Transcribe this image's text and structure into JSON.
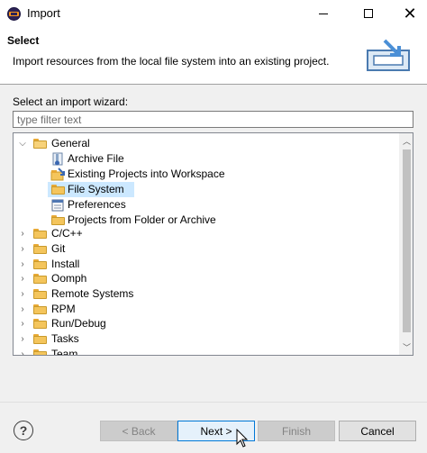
{
  "window": {
    "title": "Import"
  },
  "header": {
    "title": "Select",
    "description": "Import resources from the local file system into an existing project."
  },
  "wizard": {
    "label": "Select an import wizard:",
    "filter_placeholder": "type filter text",
    "filter_value": ""
  },
  "tree": {
    "items": [
      {
        "label": "General",
        "level": 0,
        "expanded": true,
        "icon": "folder-open-icon"
      },
      {
        "label": "Archive File",
        "level": 1,
        "icon": "archive-file-icon"
      },
      {
        "label": "Existing Projects into Workspace",
        "level": 1,
        "icon": "existing-projects-icon"
      },
      {
        "label": "File System",
        "level": 1,
        "icon": "folder-icon",
        "selected": true
      },
      {
        "label": "Preferences",
        "level": 1,
        "icon": "preferences-icon"
      },
      {
        "label": "Projects from Folder or Archive",
        "level": 1,
        "icon": "folder-icon"
      },
      {
        "label": "C/C++",
        "level": 0,
        "expanded": false,
        "icon": "folder-icon"
      },
      {
        "label": "Git",
        "level": 0,
        "expanded": false,
        "icon": "folder-icon"
      },
      {
        "label": "Install",
        "level": 0,
        "expanded": false,
        "icon": "folder-icon"
      },
      {
        "label": "Oomph",
        "level": 0,
        "expanded": false,
        "icon": "folder-icon"
      },
      {
        "label": "Remote Systems",
        "level": 0,
        "expanded": false,
        "icon": "folder-icon"
      },
      {
        "label": "RPM",
        "level": 0,
        "expanded": false,
        "icon": "folder-icon"
      },
      {
        "label": "Run/Debug",
        "level": 0,
        "expanded": false,
        "icon": "folder-icon"
      },
      {
        "label": "Tasks",
        "level": 0,
        "expanded": false,
        "icon": "folder-icon"
      },
      {
        "label": "Team",
        "level": 0,
        "expanded": false,
        "icon": "folder-icon"
      }
    ]
  },
  "buttons": {
    "help": "?",
    "back": "< Back",
    "next": "Next >",
    "finish": "Finish",
    "cancel": "Cancel"
  },
  "colors": {
    "selection": "#cce8ff",
    "default_button_border": "#0078d7",
    "folder": "#f4c55c"
  }
}
